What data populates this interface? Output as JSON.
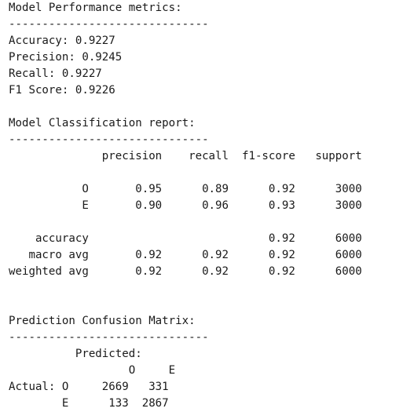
{
  "output": {
    "lines": [
      "Model Performance metrics:",
      "------------------------------",
      "Accuracy: 0.9227",
      "Precision: 0.9245",
      "Recall: 0.9227",
      "F1 Score: 0.9226",
      "",
      "Model Classification report:",
      "------------------------------",
      "              precision    recall  f1-score   support",
      "",
      "           O       0.95      0.89      0.92      3000",
      "           E       0.90      0.96      0.93      3000",
      "",
      "    accuracy                           0.92      6000",
      "   macro avg       0.92      0.92      0.92      6000",
      "weighted avg       0.92      0.92      0.92      6000",
      "",
      "",
      "Prediction Confusion Matrix:",
      "------------------------------",
      "          Predicted:",
      "                  O     E",
      "Actual: O     2669   331",
      "        E      133  2867"
    ]
  }
}
